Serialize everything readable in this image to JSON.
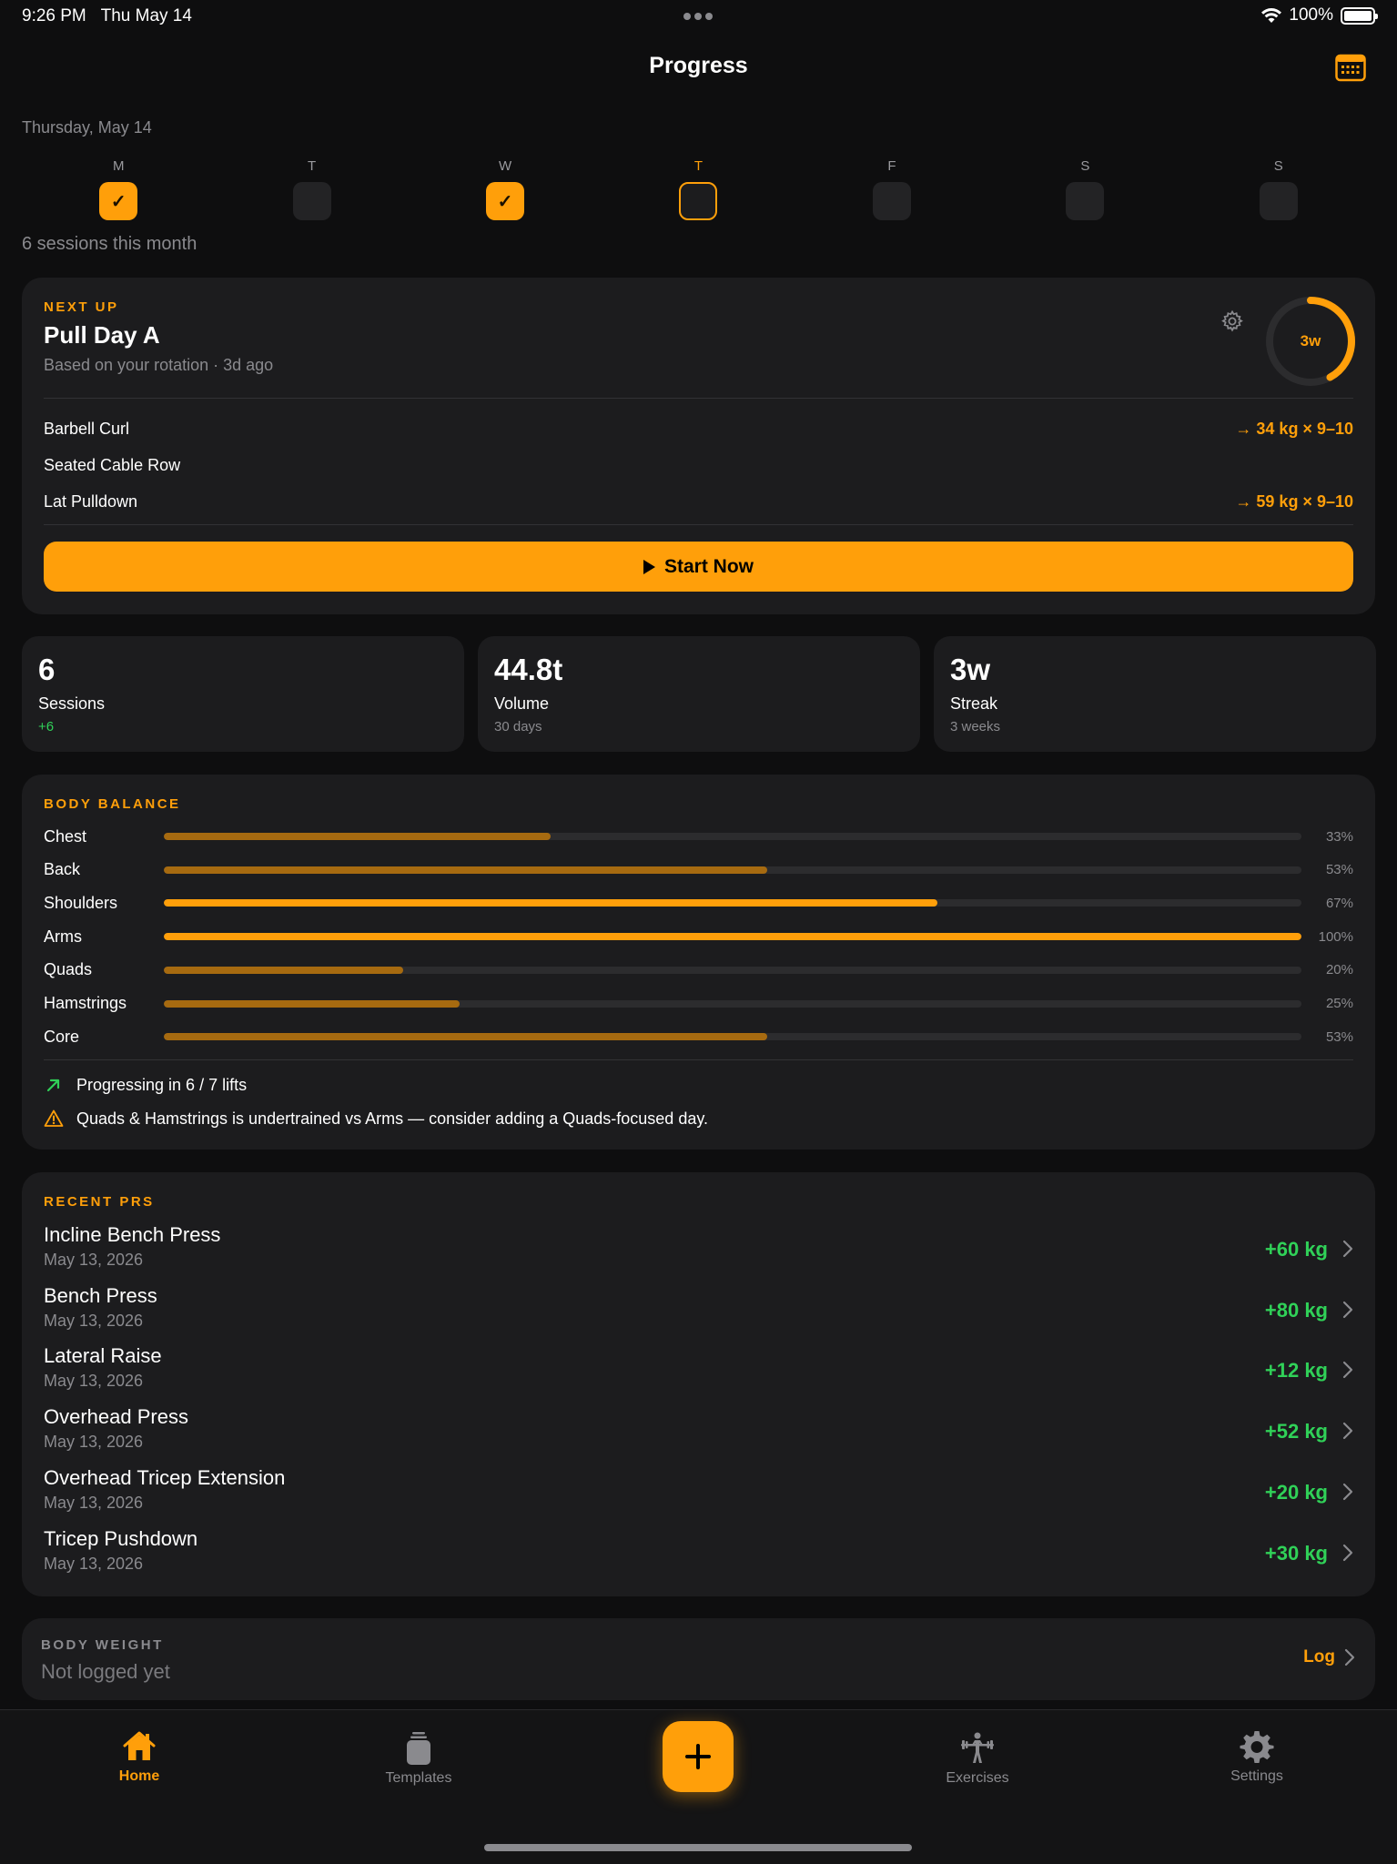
{
  "status": {
    "time": "9:26 PM",
    "date": "Thu May 14",
    "battery": "100%"
  },
  "header": {
    "title": "Progress",
    "calendar_icon": "calendar-icon"
  },
  "week": {
    "date_label": "Thursday, May 14",
    "days": [
      {
        "letter": "M",
        "state": "done",
        "check": "✓"
      },
      {
        "letter": "T",
        "state": "empty",
        "check": ""
      },
      {
        "letter": "W",
        "state": "done",
        "check": "✓"
      },
      {
        "letter": "T",
        "state": "today",
        "check": ""
      },
      {
        "letter": "F",
        "state": "empty",
        "check": ""
      },
      {
        "letter": "S",
        "state": "empty",
        "check": ""
      },
      {
        "letter": "S",
        "state": "empty",
        "check": ""
      }
    ],
    "sessions_month": "6 sessions this month"
  },
  "next_up": {
    "label": "NEXT UP",
    "title": "Pull Day A",
    "subtitle": "Based on your rotation · 3d ago",
    "ring_label": "3w",
    "ring_progress": 0.42,
    "exercises": [
      {
        "name": "Barbell Curl",
        "target": "→ 34 kg × 9–10"
      },
      {
        "name": "Seated Cable Row",
        "target": ""
      },
      {
        "name": "Lat Pulldown",
        "target": "→ 59 kg × 9–10"
      }
    ],
    "start_label": "Start Now"
  },
  "stats": [
    {
      "value": "6",
      "label": "Sessions",
      "sub": "+6"
    },
    {
      "value": "44.8t",
      "label": "Volume",
      "sub": "30 days"
    },
    {
      "value": "3w",
      "label": "Streak",
      "sub": "3 weeks"
    }
  ],
  "body_balance": {
    "label": "BODY BALANCE",
    "rows": [
      {
        "name": "Chest",
        "pct": "33%",
        "value": 0.34
      },
      {
        "name": "Back",
        "pct": "53%",
        "value": 0.53
      },
      {
        "name": "Shoulders",
        "pct": "67%",
        "value": 0.68
      },
      {
        "name": "Arms",
        "pct": "100%",
        "value": 1.0
      },
      {
        "name": "Quads",
        "pct": "20%",
        "value": 0.21
      },
      {
        "name": "Hamstrings",
        "pct": "25%",
        "value": 0.26
      },
      {
        "name": "Core",
        "pct": "53%",
        "value": 0.53
      }
    ],
    "insight_progress": "Progressing in 6 / 7 lifts",
    "insight_warning": "Quads & Hamstrings is undertrained vs Arms — consider adding a Quads-focused day."
  },
  "recent_prs": {
    "label": "RECENT PRS",
    "items": [
      {
        "name": "Incline Bench Press",
        "date": "May 13, 2026",
        "gain": "+60 kg"
      },
      {
        "name": "Bench Press",
        "date": "May 13, 2026",
        "gain": "+80 kg"
      },
      {
        "name": "Lateral Raise",
        "date": "May 13, 2026",
        "gain": "+12 kg"
      },
      {
        "name": "Overhead Press",
        "date": "May 13, 2026",
        "gain": "+52 kg"
      },
      {
        "name": "Overhead Tricep Extension",
        "date": "May 13, 2026",
        "gain": "+20 kg"
      },
      {
        "name": "Tricep Pushdown",
        "date": "May 13, 2026",
        "gain": "+30 kg"
      }
    ]
  },
  "body_weight": {
    "label": "BODY WEIGHT",
    "value": "Not logged yet",
    "log_label": "Log"
  },
  "tabs": [
    {
      "label": "Home",
      "icon": "home-icon",
      "active": true
    },
    {
      "label": "Templates",
      "icon": "templates-icon",
      "active": false
    },
    {
      "label": "Exercises",
      "icon": "exercises-icon",
      "active": false
    },
    {
      "label": "Settings",
      "icon": "settings-icon",
      "active": false
    }
  ],
  "colors": {
    "accent": "#ff9f0a",
    "positive": "#30d158",
    "background": "#0e0e0f",
    "card": "#1c1c1e"
  }
}
